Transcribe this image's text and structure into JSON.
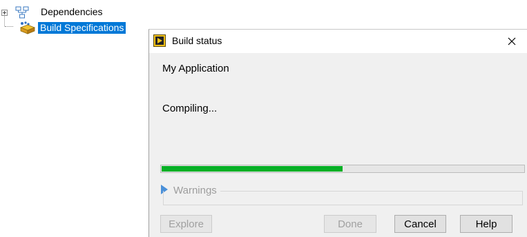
{
  "tree": {
    "items": [
      {
        "label": "Dependencies",
        "icon": "dependencies-icon"
      },
      {
        "label": "Build Specifications",
        "icon": "build-specifications-icon",
        "selected": true
      }
    ]
  },
  "dialog": {
    "title": "Build status",
    "close_symbol": "✕",
    "app_name": "My Application",
    "status": "Compiling...",
    "progress": 0.5,
    "warnings_label": "Warnings",
    "buttons": {
      "explore": "Explore",
      "done": "Done",
      "cancel": "Cancel",
      "help": "Help"
    }
  },
  "colors": {
    "selection": "#0078d7",
    "progress": "#06b025",
    "disabled_text": "#a0a0a0"
  }
}
